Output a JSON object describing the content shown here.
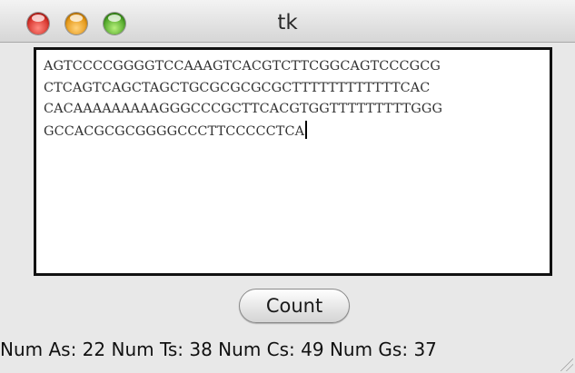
{
  "window": {
    "title": "tk"
  },
  "textarea": {
    "lines": [
      "AGTCCCCGGGGTCCAAAGTCACGTCTTCGGCAGTCCCGCG",
      "CTCAGTCAGCTAGCTGCGCGCGCGCTTTTTTTTTTTTCAC",
      "CACAAAAAAAAAGGGCCCGCTTCACGTGGTTTTTTTTTGGG",
      "GCCACGCGCGGGGCCCTTCCCCCTCA"
    ]
  },
  "button": {
    "count_label": "Count"
  },
  "status": {
    "text": "Num As: 22 Num Ts: 38 Num Cs: 49 Num Gs: 37"
  },
  "colors": {
    "window_bg": "#e8e8e8",
    "close": "#d0241d",
    "minimize": "#e08d06",
    "zoom": "#3f9a1c"
  },
  "icons": [
    "close-button-icon",
    "minimize-button-icon",
    "zoom-button-icon",
    "resize-grip-icon"
  ]
}
